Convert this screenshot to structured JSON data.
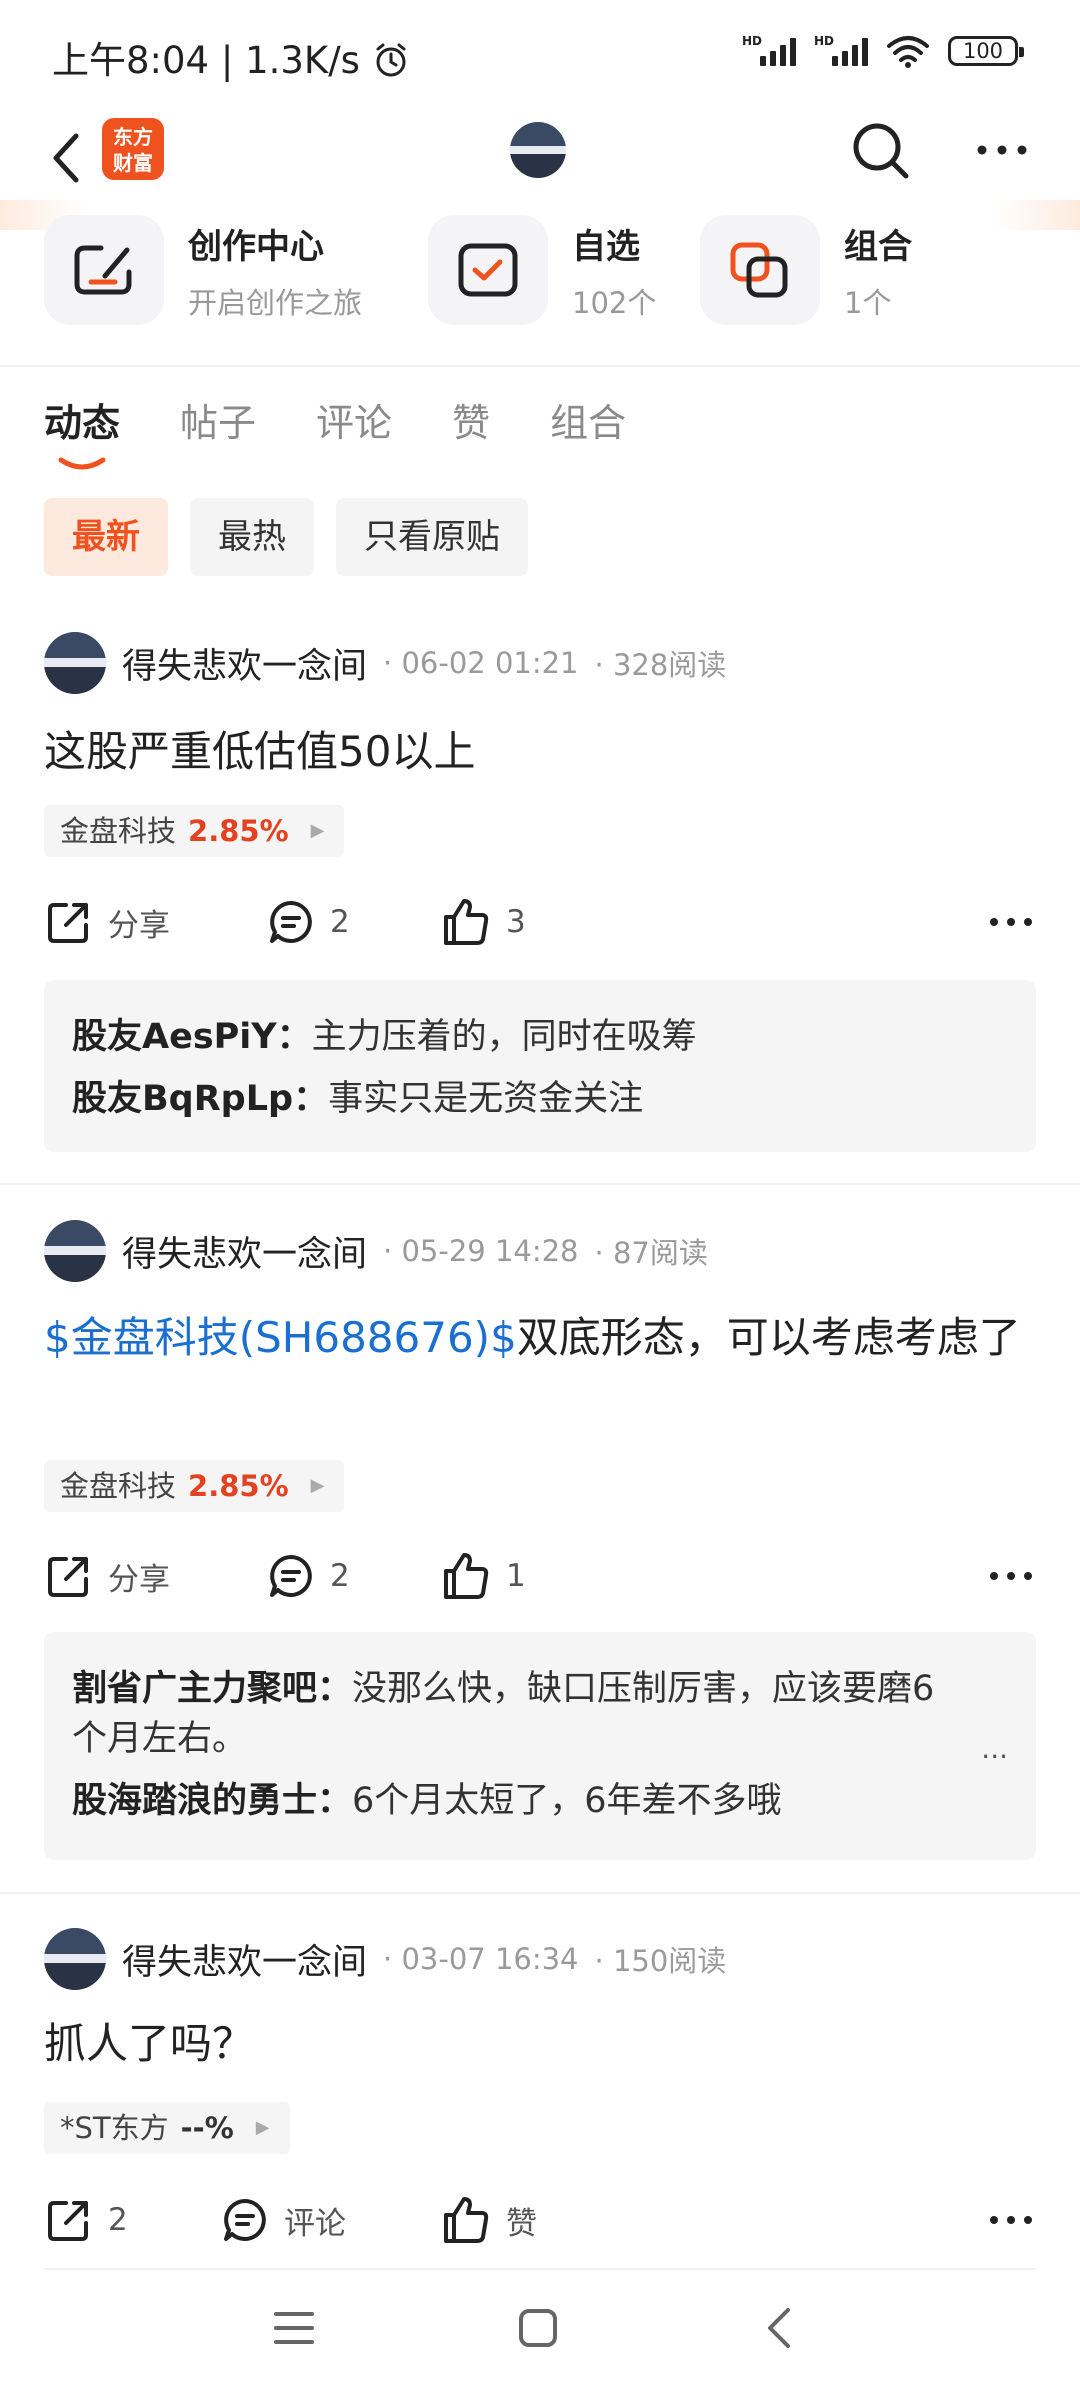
{
  "status_bar": {
    "time": "上午8:04",
    "speed": "1.3K/s",
    "battery": "100"
  },
  "top_nav": {
    "logo_line1": "东方",
    "logo_line2": "财富"
  },
  "quick_entries": [
    {
      "title": "创作中心",
      "sub": "开启创作之旅"
    },
    {
      "title": "自选",
      "sub": "102个"
    },
    {
      "title": "组合",
      "sub": "1个"
    }
  ],
  "tabs": [
    "动态",
    "帖子",
    "评论",
    "赞",
    "组合"
  ],
  "filters": [
    "最新",
    "最热",
    "只看原贴"
  ],
  "posts": [
    {
      "author": "得失悲欢一念间",
      "date": "· 06-02 01:21",
      "reads": "· 328阅读",
      "body": "这股严重低估值50以上",
      "stock": "金盘科技",
      "stock_change": "2.85%",
      "share": "分享",
      "comments": "2",
      "likes": "3",
      "replies": [
        {
          "name": "股友AesPiY：",
          "text": "主力压着的，同时在吸筹"
        },
        {
          "name": "股友BqRpLp：",
          "text": "事实只是无资金关注"
        }
      ]
    },
    {
      "author": "得失悲欢一念间",
      "date": "· 05-29 14:28",
      "reads": "· 87阅读",
      "body_link": "$金盘科技(SH688676)$",
      "body": "双底形态，可以考虑考虑了",
      "stock": "金盘科技",
      "stock_change": "2.85%",
      "share": "分享",
      "comments": "2",
      "likes": "1",
      "replies": [
        {
          "name": "割省广主力聚吧：",
          "text": "没那么快，缺口压制厉害，应该要磨6个月左右。"
        },
        {
          "name": "股海踏浪的勇士：",
          "text": "6个月太短了，6年差不多哦"
        }
      ],
      "replies_more": "..."
    },
    {
      "author": "得失悲欢一念间",
      "date": "· 03-07 16:34",
      "reads": "· 150阅读",
      "body": "抓人了吗？",
      "stock": "*ST东方",
      "stock_change": "--%",
      "share": "2",
      "comments": "评论",
      "likes": "赞"
    }
  ],
  "colors": {
    "accent": "#f0521f",
    "link": "#1a6fd0",
    "up": "#e2421f"
  }
}
